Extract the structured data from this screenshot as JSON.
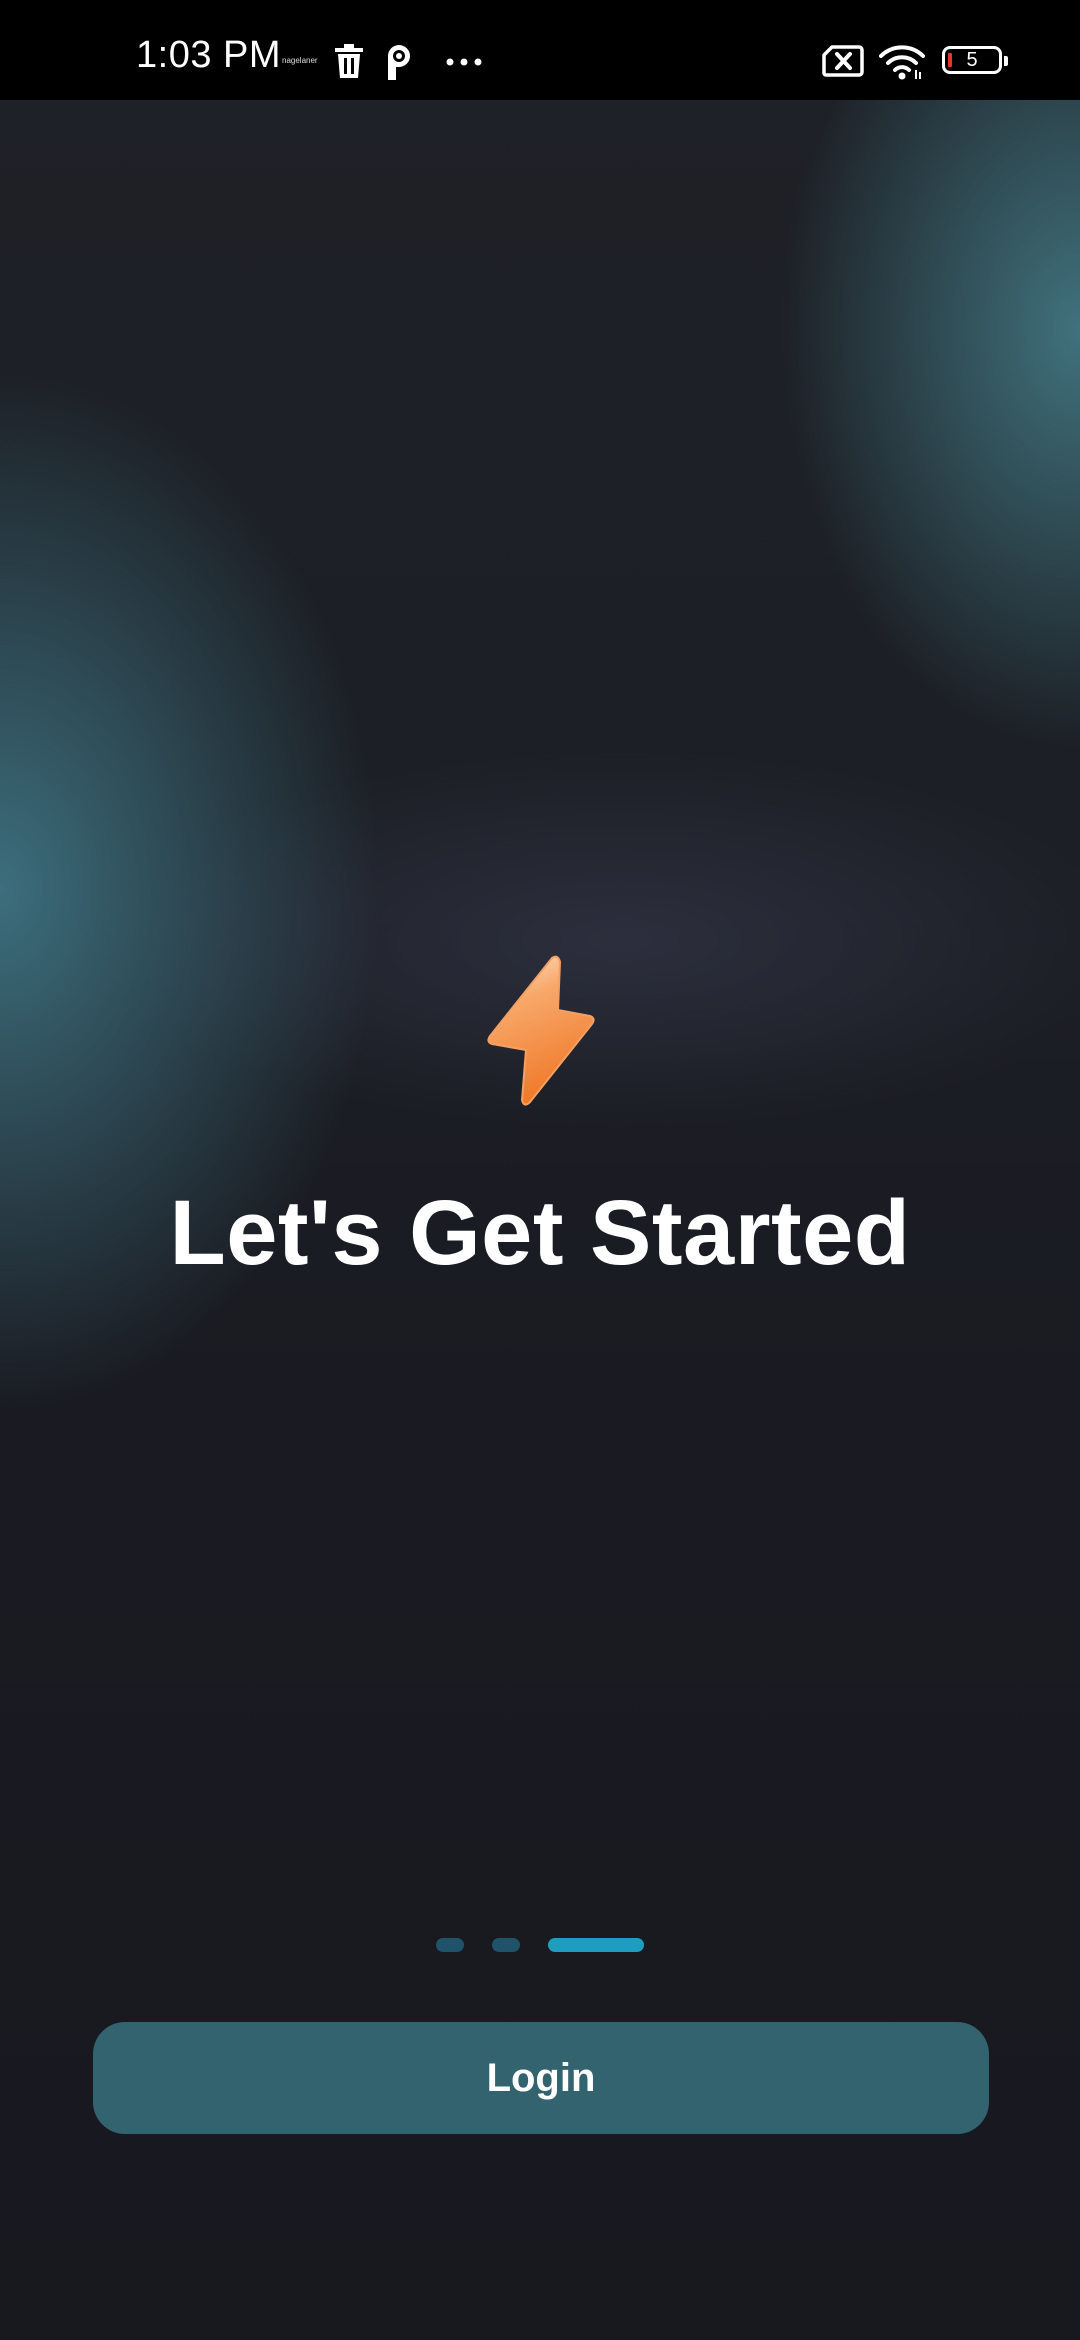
{
  "status_bar": {
    "time": "1:03 PM",
    "tiny_label": "nagelaner",
    "battery_level": "5",
    "icons": [
      "trash-icon",
      "p-badge-icon",
      "more-dots-icon",
      "no-sim-icon",
      "wifi-icon",
      "battery-icon"
    ]
  },
  "welcome": {
    "icon": "lightning-bolt-icon",
    "headline": "Let's Get Started"
  },
  "pager": {
    "page_count": 3,
    "active_index": 2,
    "colors": {
      "inactive": "#1f5369",
      "active": "#1f9dc0"
    }
  },
  "actions": {
    "login_label": "Login"
  },
  "colors": {
    "background": "#18181f",
    "button": "#33636f",
    "bolt": "#f5893a"
  }
}
